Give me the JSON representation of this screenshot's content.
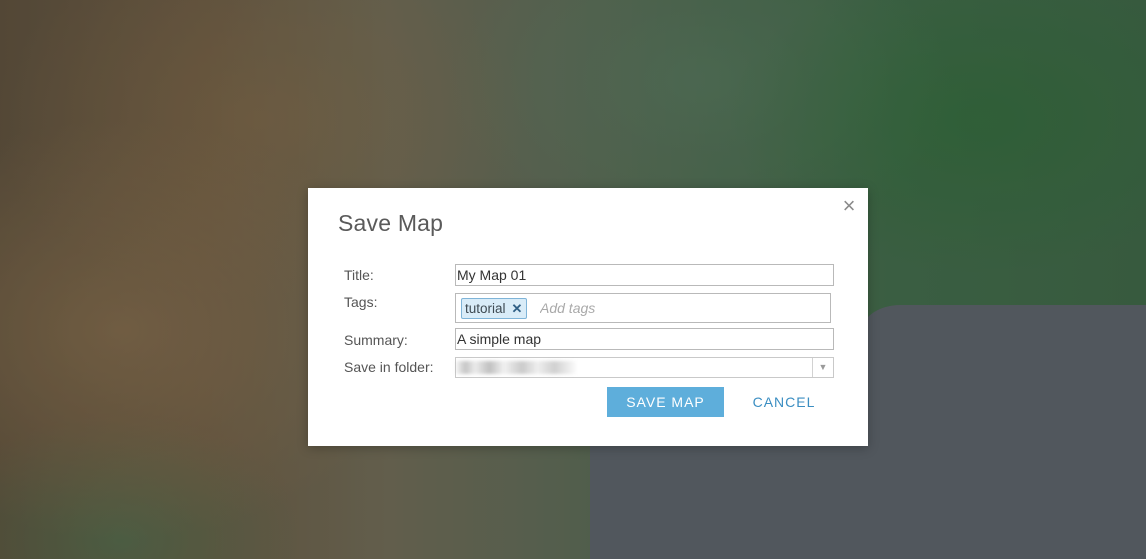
{
  "dialog": {
    "title": "Save Map",
    "close_icon": "close-icon",
    "fields": {
      "title_label": "Title:",
      "title_value": "My Map 01",
      "tags_label": "Tags:",
      "tags": [
        "tutorial"
      ],
      "tags_placeholder": "Add tags",
      "summary_label": "Summary:",
      "summary_value": "A simple map",
      "folder_label": "Save in folder:"
    },
    "buttons": {
      "save_label": "SAVE MAP",
      "cancel_label": "CANCEL"
    }
  },
  "colors": {
    "primary_button": "#5eaedb",
    "link_button": "#3b8ec2",
    "tag_chip_background": "#d9ecf8",
    "tag_chip_border": "#7fb4d8"
  }
}
